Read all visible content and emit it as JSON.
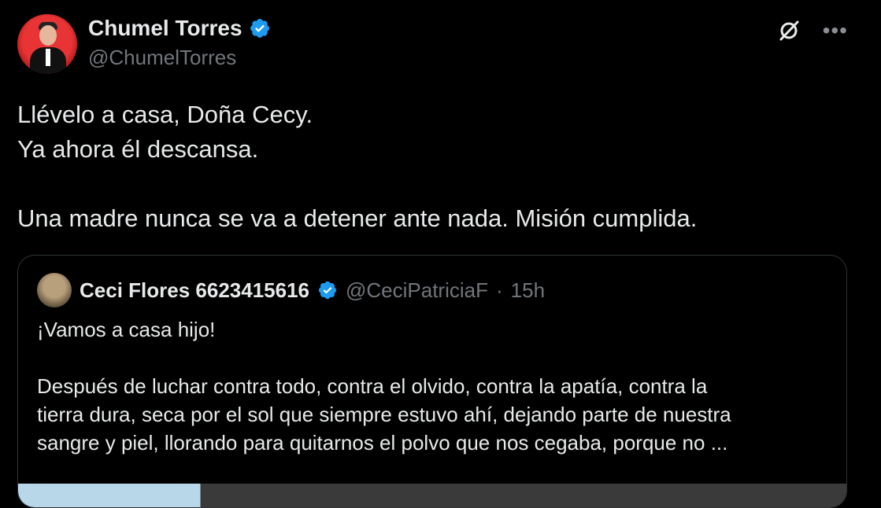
{
  "author": {
    "name": "Chumel Torres",
    "handle": "@ChumelTorres"
  },
  "tweet": {
    "lines": [
      "Llévelo a casa, Doña Cecy.",
      "Ya ahora él descansa.",
      "",
      "Una madre nunca se va a detener ante nada. Misión cumplida."
    ]
  },
  "quote": {
    "name": "Ceci Flores 6623415616",
    "handle": "@CeciPatriciaF",
    "separator": "·",
    "time": "15h",
    "lines": [
      "¡Vamos a casa hijo!",
      "",
      "Después de luchar contra todo, contra el olvido, contra la apatía, contra la",
      "tierra dura, seca por el sol que siempre estuvo ahí, dejando parte de nuestra",
      "sangre y piel, llorando para quitarnos el polvo que nos cegaba, porque no ..."
    ]
  },
  "icons": {
    "verified": "verified-badge-icon",
    "grok": "grok-icon",
    "more": "more-icon"
  },
  "colors": {
    "background": "#000000",
    "text": "#e7e9ea",
    "secondary": "#71767b",
    "verified": "#1d9bf0",
    "border": "#2f3336"
  }
}
